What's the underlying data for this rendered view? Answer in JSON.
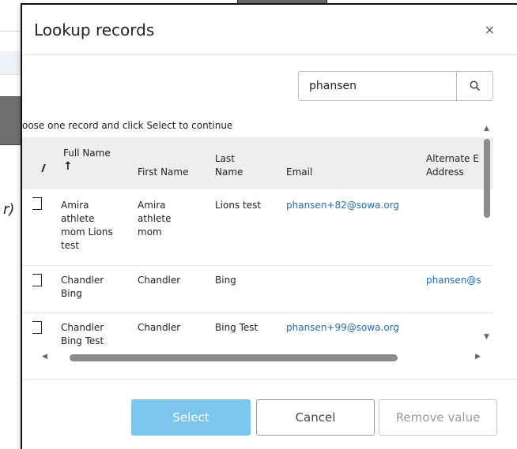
{
  "dialog": {
    "title": "Lookup records",
    "close_label": "×"
  },
  "search": {
    "value": "phansen",
    "icon": "search-icon"
  },
  "instructions": "oose one record and click Select to continue",
  "table": {
    "headers": {
      "full_name": "Full Name",
      "full_name_sort": "↑",
      "first_name": "First Name",
      "last_name_1": "Last",
      "last_name_2": "Name",
      "email": "Email",
      "alt_email_1": "Alternate E",
      "alt_email_2": "Address"
    },
    "rows": [
      {
        "full_name_lines": [
          "Amira",
          "athlete",
          "mom Lions",
          "test"
        ],
        "first_name_lines": [
          "Amira",
          "athlete",
          "mom"
        ],
        "last_name": "Lions test",
        "email": "phansen+82@sowa.org",
        "alt_email": ""
      },
      {
        "full_name_lines": [
          "Chandler",
          "Bing"
        ],
        "first_name_lines": [
          "Chandler"
        ],
        "last_name": "Bing",
        "email": "",
        "alt_email": "phansen@s"
      },
      {
        "full_name_lines": [
          "Chandler",
          "Bing Test"
        ],
        "first_name_lines": [
          "Chandler"
        ],
        "last_name": "Bing Test",
        "email": "phansen+99@sowa.org",
        "alt_email": ""
      }
    ]
  },
  "buttons": {
    "select": "Select",
    "cancel": "Cancel",
    "remove": "Remove value"
  },
  "background": {
    "partial_glyph": "r)"
  },
  "colors": {
    "select_button": "#7cc6ec",
    "link": "#1e6fb3",
    "header_bg": "#eeeeee"
  }
}
